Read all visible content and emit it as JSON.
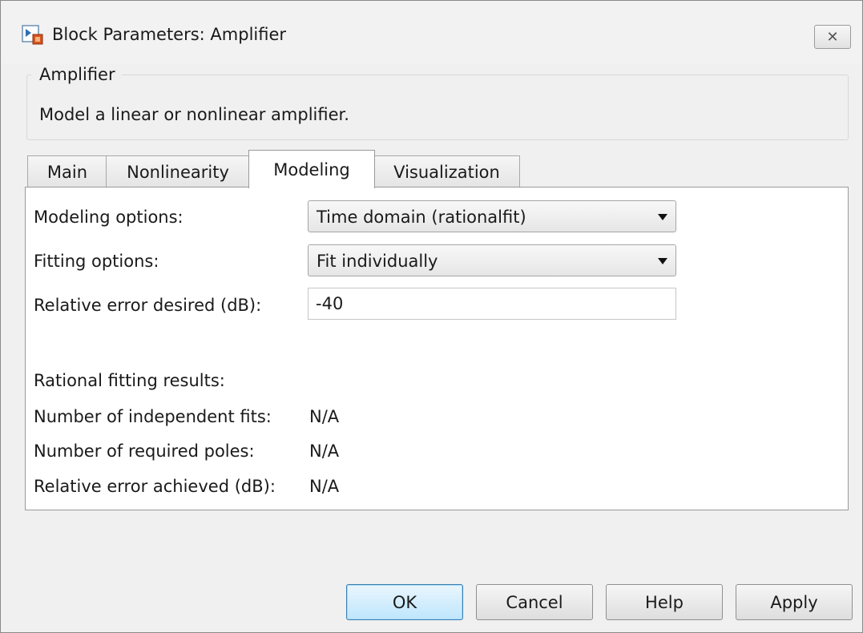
{
  "window": {
    "title": "Block Parameters: Amplifier",
    "close_glyph": "✕",
    "icon": "simulink-block-icon"
  },
  "group": {
    "legend": "Amplifier",
    "description": "Model a linear or nonlinear amplifier."
  },
  "tabs": [
    {
      "label": "Main",
      "active": false
    },
    {
      "label": "Nonlinearity",
      "active": false
    },
    {
      "label": "Modeling",
      "active": true
    },
    {
      "label": "Visualization",
      "active": false
    }
  ],
  "form": {
    "modeling_options_label": "Modeling options:",
    "modeling_options_value": "Time domain (rationalfit)",
    "fitting_options_label": "Fitting options:",
    "fitting_options_value": "Fit individually",
    "relative_error_desired_label": "Relative error desired (dB):",
    "relative_error_desired_value": "-40"
  },
  "results": {
    "heading": "Rational fitting results:",
    "independent_fits_label": "Number of independent fits:",
    "independent_fits_value": "N/A",
    "required_poles_label": "Number of required poles:",
    "required_poles_value": "N/A",
    "error_achieved_label": "Relative error achieved (dB):",
    "error_achieved_value": "N/A"
  },
  "buttons": {
    "ok": "OK",
    "cancel": "Cancel",
    "help": "Help",
    "apply": "Apply"
  },
  "colors": {
    "dialog_bg": "#f0f0f0",
    "panel_bg": "#ffffff",
    "default_button_border": "#3c7fb1",
    "default_button_fill": "#bee6fd"
  }
}
